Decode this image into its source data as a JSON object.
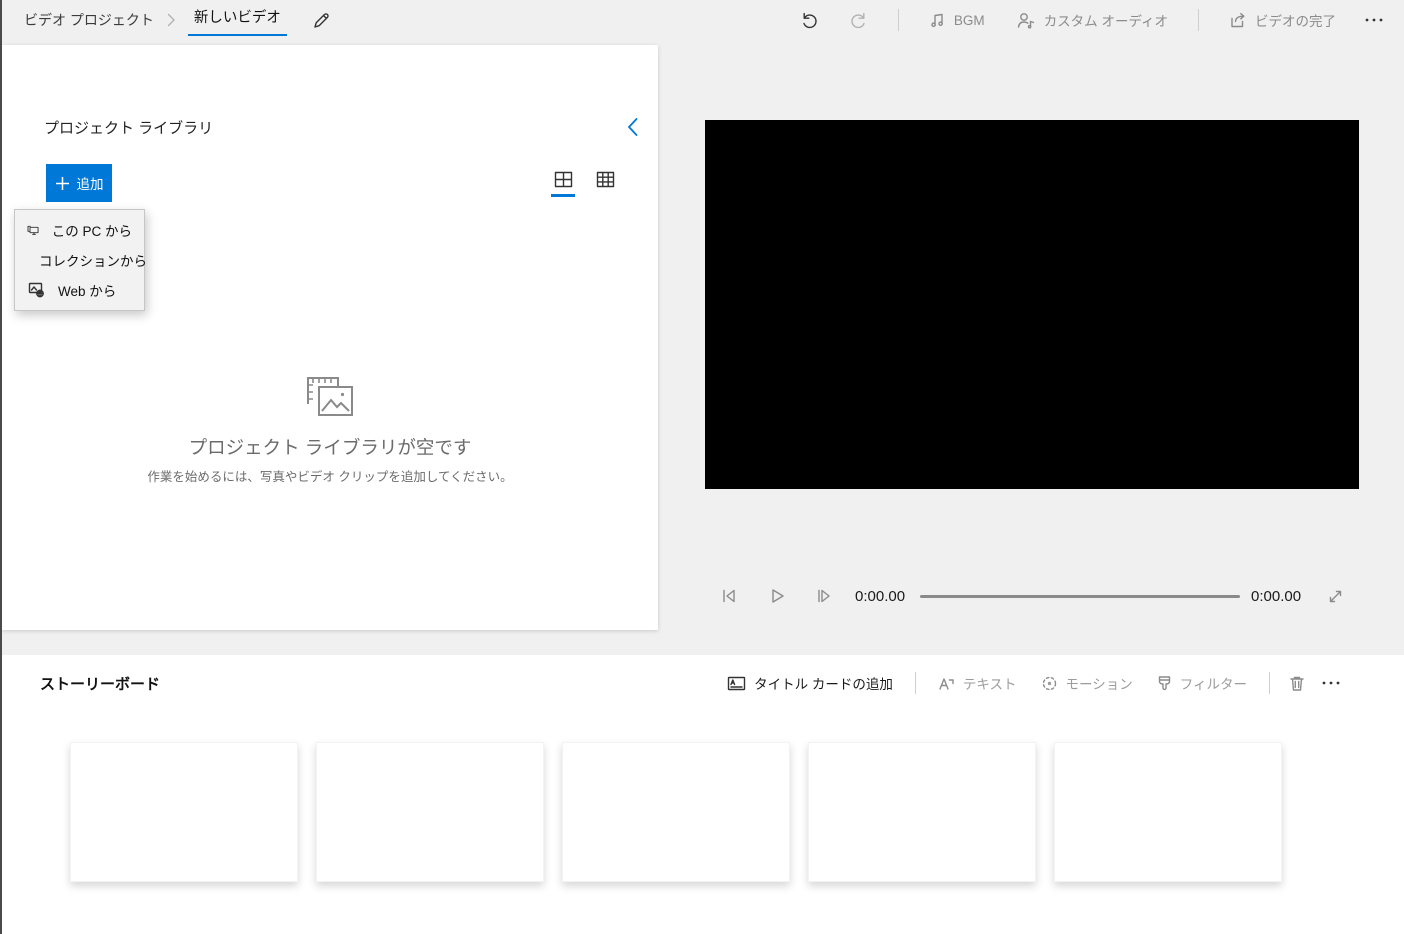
{
  "titlebar": {
    "breadcrumb": "ビデオ プロジェクト",
    "project_title": "新しいビデオ",
    "bgm_label": "BGM",
    "custom_audio_label": "カスタム オーディオ",
    "finish_video_label": "ビデオの完了"
  },
  "library": {
    "title": "プロジェクト ライブラリ",
    "add_button_label": "追加",
    "add_menu_items": [
      {
        "label": "この PC から",
        "icon": "pc-icon"
      },
      {
        "label": "コレクションから",
        "icon": "collection-icon"
      },
      {
        "label": "Web から",
        "icon": "web-globe-icon"
      }
    ],
    "empty_state": {
      "title": "プロジェクト ライブラリが空です",
      "subtitle": "作業を始めるには、写真やビデオ クリップを追加してください。"
    }
  },
  "player": {
    "elapsed": "0:00.00",
    "duration": "0:00.00"
  },
  "storyboard": {
    "title": "ストーリーボード",
    "toolbar": {
      "add_title_card": "タイトル カードの追加",
      "text": "テキスト",
      "motion": "モーション",
      "filter": "フィルター"
    },
    "placeholder_count": 5
  },
  "colors": {
    "accent": "#0078d7",
    "app_background": "#f0f0f0",
    "video_background": "#000000",
    "disabled_text": "#9c9c9c"
  }
}
